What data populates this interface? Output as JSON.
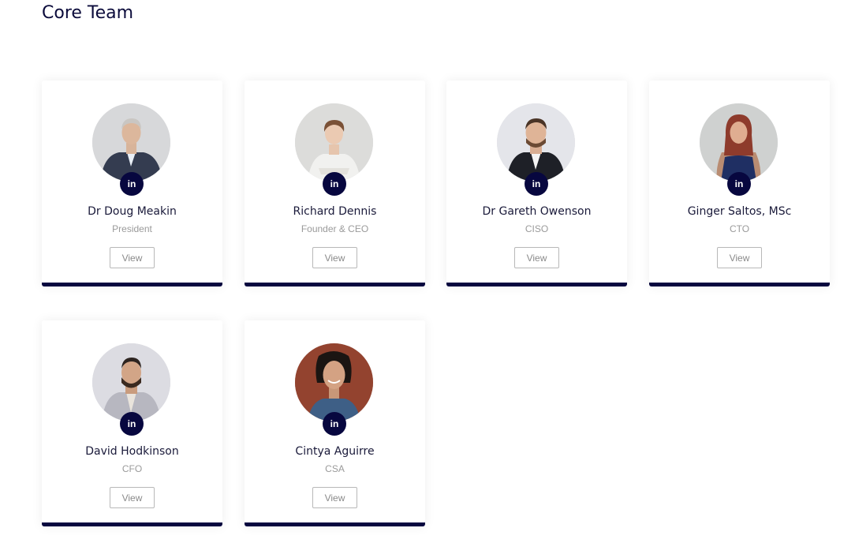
{
  "section": {
    "title": "Core Team"
  },
  "linkedin_label": "in",
  "members": [
    {
      "name": "Dr Doug Meakin",
      "role": "President",
      "view_label": "View"
    },
    {
      "name": "Richard Dennis",
      "role": "Founder & CEO",
      "view_label": "View"
    },
    {
      "name": "Dr Gareth Owenson",
      "role": "CISO",
      "view_label": "View"
    },
    {
      "name": "Ginger Saltos, MSc",
      "role": "CTO",
      "view_label": "View"
    },
    {
      "name": "David Hodkinson",
      "role": "CFO",
      "view_label": "View"
    },
    {
      "name": "Cintya Aguirre",
      "role": "CSA",
      "view_label": "View"
    }
  ],
  "colors": {
    "accent": "#07073f",
    "muted_text": "#9a9a9a",
    "title": "#0b0b3b"
  }
}
